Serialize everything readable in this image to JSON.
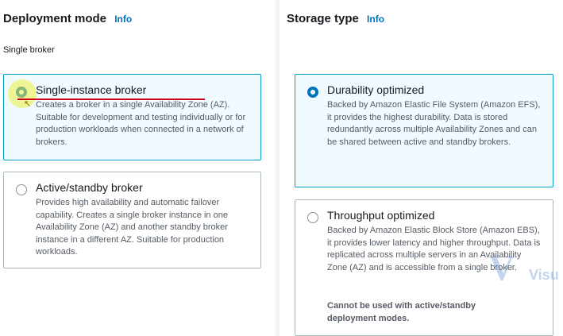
{
  "deployment": {
    "title": "Deployment mode",
    "info": "Info",
    "subheading": "Single broker",
    "options": [
      {
        "label": "Single-instance broker",
        "description": "Creates a broker in a single Availability Zone (AZ). Suitable for development and testing individually or for production workloads when connected in a network of brokers.",
        "selected": true
      },
      {
        "label": "Active/standby broker",
        "description": "Provides high availability and automatic failover capability. Creates a single broker instance in one Availability Zone (AZ) and another standby broker instance in a different AZ. Suitable for production workloads.",
        "selected": false
      }
    ]
  },
  "storage": {
    "title": "Storage type",
    "info": "Info",
    "options": [
      {
        "label": "Durability optimized",
        "description": "Backed by Amazon Elastic File System (Amazon EFS), it provides the highest durability. Data is stored redundantly across multiple Availability Zones and can be shared between active and standby brokers.",
        "selected": true
      },
      {
        "label": "Throughput optimized",
        "description": "Backed by Amazon Elastic Block Store (Amazon EBS), it provides lower latency and higher throughput. Data is replicated across multiple servers in an Availability Zone (AZ) and is accessible from a single broker.",
        "note": "Cannot be used with active/standby deployment modes.",
        "selected": false
      }
    ]
  },
  "watermark": {
    "text": "Visu"
  },
  "colors": {
    "accent": "#0073bb",
    "selected_border": "#00a1c9",
    "selected_bg": "#f1faff",
    "annotation_underline": "#d0021b",
    "annotation_highlight": "#ebf03c"
  }
}
